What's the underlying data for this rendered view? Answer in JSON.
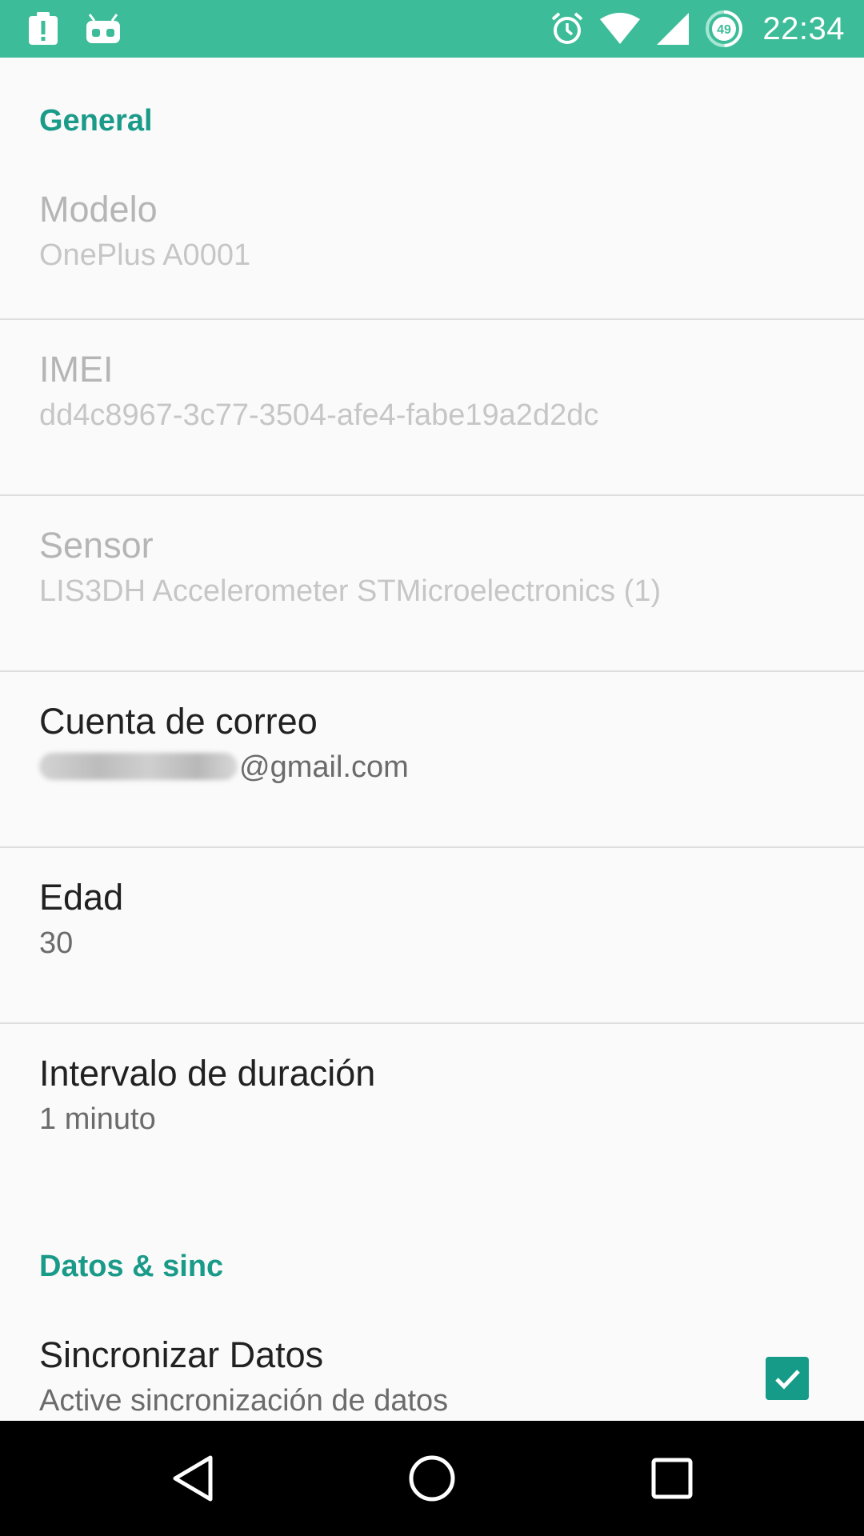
{
  "status_bar": {
    "time": "22:34",
    "battery_level": "49",
    "bg_color": "#3cbc98",
    "left_icons": [
      "notification-alert-icon",
      "android-debug-icon"
    ],
    "right_icons": [
      "alarm-icon",
      "wifi-icon",
      "cell-signal-icon",
      "battery-icon"
    ]
  },
  "sections": {
    "general": {
      "header": "General"
    },
    "sync": {
      "header": "Datos & sinc"
    }
  },
  "prefs": {
    "modelo": {
      "title": "Modelo",
      "summary": "OnePlus A0001"
    },
    "imei": {
      "title": "IMEI",
      "summary": "dd4c8967-3c77-3504-afe4-fabe19a2d2dc"
    },
    "sensor": {
      "title": "Sensor",
      "summary": "LIS3DH Accelerometer STMicroelectronics (1)"
    },
    "cuenta": {
      "title": "Cuenta de correo",
      "summary_suffix": "@gmail.com"
    },
    "edad": {
      "title": "Edad",
      "summary": "30"
    },
    "intervalo": {
      "title": "Intervalo de duración",
      "summary": "1 minuto"
    },
    "sincronizar": {
      "title": "Sincronizar Datos",
      "summary": "Active sincronización de datos",
      "checked": true
    }
  },
  "colors": {
    "accent": "#1a9a88",
    "checkbox": "#169b88"
  },
  "nav_bar": {
    "buttons": [
      "back-icon",
      "home-icon",
      "recents-icon"
    ]
  }
}
